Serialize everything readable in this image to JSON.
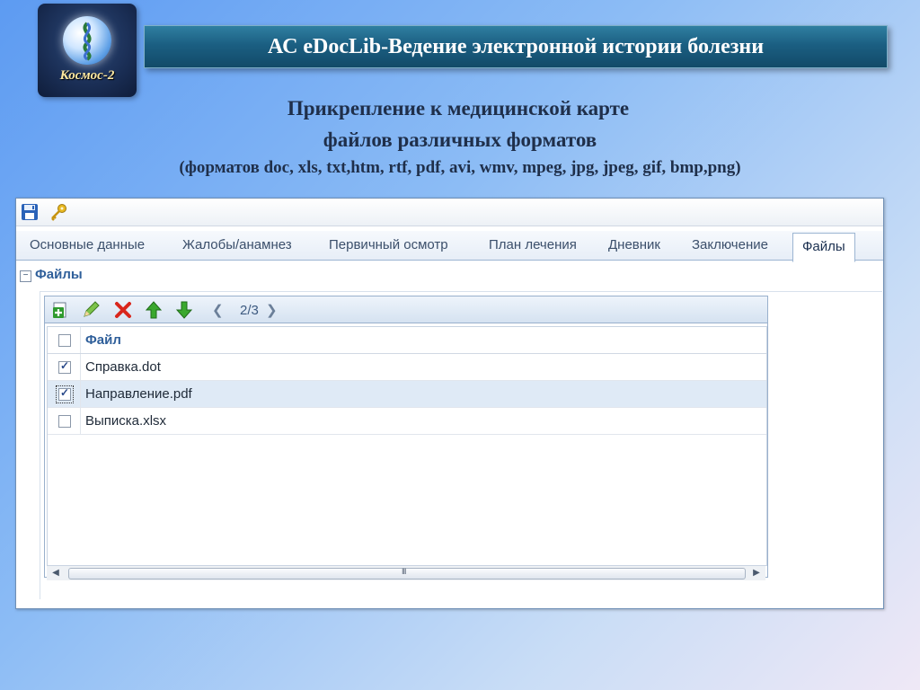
{
  "logo": {
    "text": "Космос-2"
  },
  "banner": {
    "title": "АС  eDocLib-Ведение электронной истории болезни"
  },
  "headings": {
    "line1": "Прикрепление к медицинской карте",
    "line2": "файлов различных форматов",
    "line3": "(форматов doc, xls, txt,htm, rtf, pdf, avi, wmv, mpeg, jpg, jpeg, gif, bmp,png)"
  },
  "tabs": [
    {
      "label": "Основные данные"
    },
    {
      "label": "Жалобы/анамнез"
    },
    {
      "label": "Первичный осмотр"
    },
    {
      "label": "План лечения"
    },
    {
      "label": "Дневник"
    },
    {
      "label": "Заключение"
    },
    {
      "label": "Файлы"
    }
  ],
  "section": {
    "title": "Файлы",
    "collapse_symbol": "−"
  },
  "grid": {
    "pager": "2/3",
    "column_header": "Файл",
    "rows": [
      {
        "name": "Справка.dot",
        "checked": true
      },
      {
        "name": "Направление.pdf",
        "checked": true
      },
      {
        "name": "Выписка.xlsx",
        "checked": false
      }
    ],
    "scroll_grip": "III"
  },
  "colors": {
    "accent": "#2f5f9a",
    "banner": "#1b5f82"
  }
}
